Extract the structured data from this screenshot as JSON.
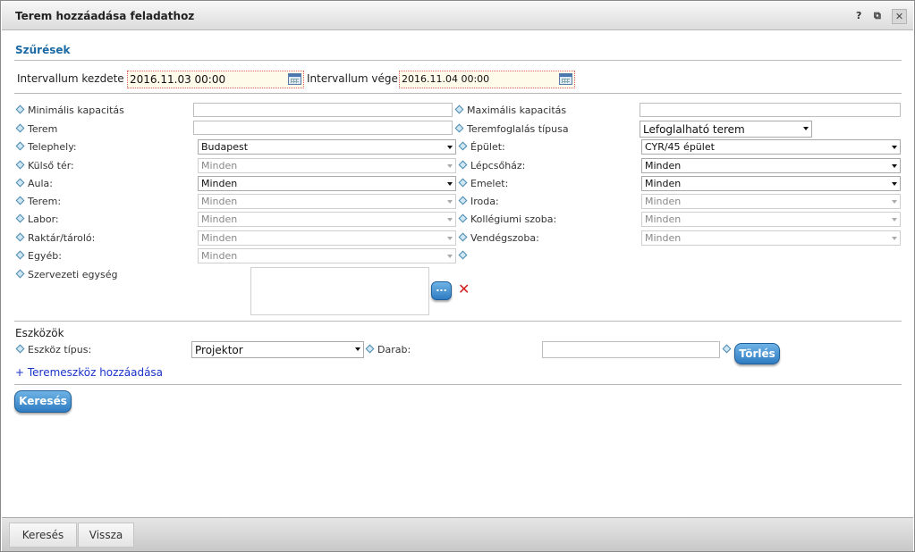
{
  "window": {
    "title": "Terem hozzáadása feladathoz",
    "help_icon": "?",
    "popout_icon": "⧉",
    "close_icon": "✕"
  },
  "filters": {
    "section_title": "Szűrések",
    "interval_start_label": "Intervallum kezdete",
    "interval_start_value": "2016.11.03 00:00",
    "interval_end_label": "Intervallum vége",
    "interval_end_value": "2016.11.04 00:00",
    "min_capacity_label": "Minimális kapacitás",
    "max_capacity_label": "Maximális kapacitás",
    "room_label": "Terem",
    "booking_type_label": "Teremfoglalás típusa",
    "booking_type_value": "Lefoglalható terem",
    "site_label": "Telephely:",
    "site_value": "Budapest",
    "building_label": "Épület:",
    "building_value": "CYR/45 épület",
    "outdoor_label": "Külső tér:",
    "outdoor_value": "Minden",
    "staircase_label": "Lépcsőház:",
    "staircase_value": "Minden",
    "hall_label": "Aula:",
    "hall_value": "Minden",
    "floor_label": "Emelet:",
    "floor_value": "Minden",
    "room2_label": "Terem:",
    "room2_value": "Minden",
    "office_label": "Iroda:",
    "office_value": "Minden",
    "lab_label": "Labor:",
    "lab_value": "Minden",
    "dorm_label": "Kollégiumi szoba:",
    "dorm_value": "Minden",
    "storage_label": "Raktár/tároló:",
    "storage_value": "Minden",
    "guestroom_label": "Vendégszoba:",
    "guestroom_value": "Minden",
    "other_label": "Egyéb:",
    "other_value": "Minden",
    "org_unit_label": "Szervezeti egység",
    "org_unit_browse": "..."
  },
  "tools": {
    "section_title": "Eszközök",
    "tool_type_label": "Eszköz típus:",
    "tool_type_value": "Projektor",
    "count_label": "Darab:",
    "delete_button": "Törlés",
    "add_link": "+ Teremeszköz hozzáadása"
  },
  "search_button": "Keresés",
  "footer": {
    "search_button": "Keresés",
    "back_button": "Vissza"
  },
  "colors": {
    "section_title": "#1a6aa5",
    "link": "#1a33c8",
    "button_blue": "#2f7cc2",
    "date_field_bg": "#fffbea"
  }
}
